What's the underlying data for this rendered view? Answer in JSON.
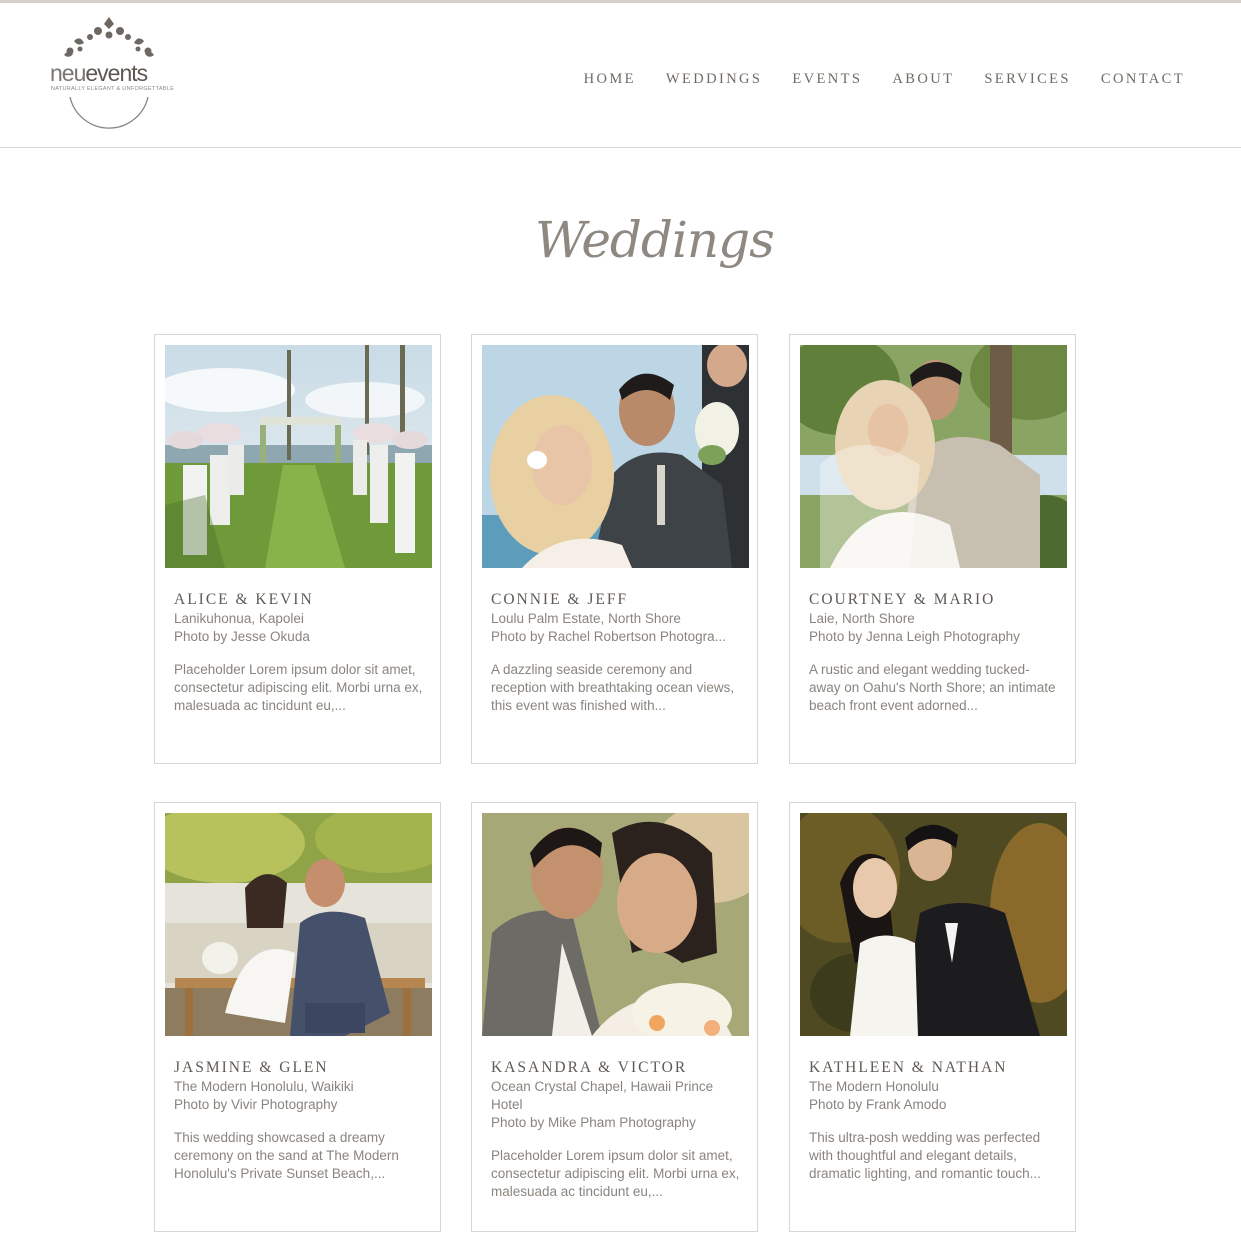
{
  "colors": {
    "accent": "#8e8880",
    "text": "#6f6a64",
    "border": "#d9d6d1"
  },
  "brand": {
    "logo_primary": "neu",
    "logo_secondary": "events",
    "tagline": "NATURALLY ELEGANT & UNFORGETTABLE"
  },
  "nav": {
    "items": [
      {
        "label": "HOME"
      },
      {
        "label": "WEDDINGS"
      },
      {
        "label": "EVENTS"
      },
      {
        "label": "ABOUT"
      },
      {
        "label": "SERVICES"
      },
      {
        "label": "CONTACT"
      }
    ]
  },
  "page": {
    "title": "Weddings"
  },
  "weddings": [
    {
      "title": "ALICE & KEVIN",
      "location": "Lanikuhonua, Kapolei",
      "credit": "Photo by Jesse Okuda",
      "description": "Placeholder Lorem ipsum dolor sit amet, consectetur adipiscing elit. Morbi urna ex, malesuada ac tincidunt eu,...",
      "photo": "ceremony-aisle-photo"
    },
    {
      "title": "CONNIE & JEFF",
      "location": "Loulu Palm Estate, North Shore",
      "credit": "Photo by Rachel Robertson Photogra...",
      "description": "A dazzling seaside ceremony and reception with breathtaking ocean views, this event was finished with...",
      "photo": "couple-ocean-photo"
    },
    {
      "title": "COURTNEY & MARIO",
      "location": "Laie, North Shore",
      "credit": "Photo by Jenna Leigh Photography",
      "description": "A rustic and elegant wedding tucked-away on Oahu's North Shore; an intimate beach front event adorned...",
      "photo": "couple-trees-photo"
    },
    {
      "title": "JASMINE & GLEN",
      "location": "The Modern Honolulu, Waikiki",
      "credit": "Photo by Vivir Photography",
      "description": "This wedding showcased a dreamy ceremony on the sand at The Modern Honolulu's Private Sunset Beach,...",
      "photo": "couple-bench-photo"
    },
    {
      "title": "KASANDRA & VICTOR",
      "location": "Ocean Crystal Chapel, Hawaii Prince Hotel",
      "credit": "Photo by Mike Pham Photography",
      "description": "Placeholder Lorem ipsum dolor sit amet, consectetur adipiscing elit. Morbi urna ex, malesuada ac tincidunt eu,...",
      "photo": "couple-kiss-photo"
    },
    {
      "title": "KATHLEEN & NATHAN",
      "location": "The Modern Honolulu",
      "credit": "Photo by Frank Amodo",
      "description": "This ultra-posh wedding was perfected with thoughtful and elegant details, dramatic lighting, and romantic touch...",
      "photo": "couple-garden-photo"
    }
  ]
}
